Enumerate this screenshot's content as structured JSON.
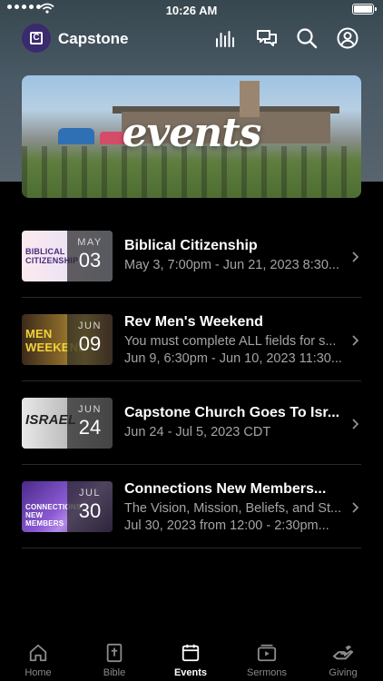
{
  "status_bar": {
    "time": "10:26 AM"
  },
  "app": {
    "name": "Capstone",
    "logo_letter": "C"
  },
  "header_icons": [
    "audio-bars-icon",
    "chat-bubbles-icon",
    "search-icon",
    "profile-icon"
  ],
  "hero": {
    "label": "events"
  },
  "events": [
    {
      "month": "MAY",
      "day": "03",
      "title": "Biblical Citizenship",
      "line1": "May 3, 7:00pm - Jun 21, 2023 8:30...",
      "line2": "",
      "thumb_text": "BIBLICAL CITIZENSHIP"
    },
    {
      "month": "JUN",
      "day": "09",
      "title": "Rev Men's Weekend",
      "line1": "You must complete ALL fields for s...",
      "line2": "Jun 9, 6:30pm - Jun 10, 2023 11:30...",
      "thumb_text": "MEN WEEKEND"
    },
    {
      "month": "JUN",
      "day": "24",
      "title": "Capstone Church Goes To Isr...",
      "line1": "Jun 24 - Jul 5, 2023 CDT",
      "line2": "",
      "thumb_text": "ISRAEL"
    },
    {
      "month": "JUL",
      "day": "30",
      "title": "Connections New Members...",
      "line1": "The Vision, Mission, Beliefs, and St...",
      "line2": "Jul 30, 2023 from 12:00 - 2:30pm...",
      "thumb_text": "CONNECTIONS NEW MEMBERS"
    }
  ],
  "tabs": [
    {
      "label": "Home",
      "icon": "home-icon",
      "active": false
    },
    {
      "label": "Bible",
      "icon": "bible-icon",
      "active": false
    },
    {
      "label": "Events",
      "icon": "calendar-icon",
      "active": true
    },
    {
      "label": "Sermons",
      "icon": "video-icon",
      "active": false
    },
    {
      "label": "Giving",
      "icon": "giving-hand-icon",
      "active": false
    }
  ],
  "colors": {
    "background": "#000000",
    "header_top": "#37474f",
    "logo": "#3a2a6e",
    "muted_text": "#a4a4a4"
  }
}
